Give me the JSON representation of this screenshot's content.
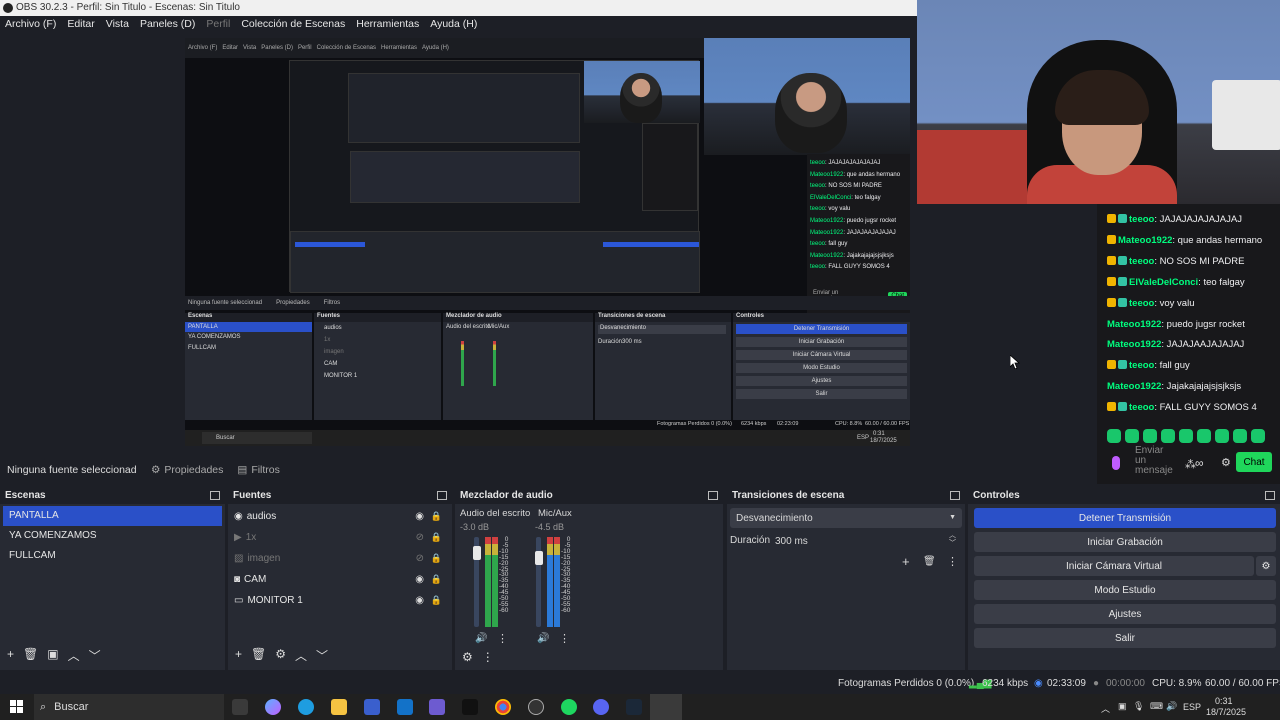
{
  "window": {
    "title": "OBS 30.2.3 - Perfil: Sin Titulo - Escenas: Sin Titulo"
  },
  "menu": [
    {
      "label": "Archivo (F)",
      "disabled": false
    },
    {
      "label": "Editar",
      "disabled": false
    },
    {
      "label": "Vista",
      "disabled": false
    },
    {
      "label": "Paneles (D)",
      "disabled": false
    },
    {
      "label": "Perfil",
      "disabled": true
    },
    {
      "label": "Colección de Escenas",
      "disabled": false
    },
    {
      "label": "Herramientas",
      "disabled": false
    },
    {
      "label": "Ayuda (H)",
      "disabled": false
    }
  ],
  "preview_inner": {
    "menu": [
      "Archivo (F)",
      "Editar",
      "Vista",
      "Paneles (D)",
      "Perfil",
      "Colección de Escenas",
      "Herramientas",
      "Ayuda (H)"
    ],
    "source_bar": [
      "Ninguna fuente seleccionad",
      "Propiedades",
      "Filtros"
    ],
    "scenes_title": "Escenas",
    "scenes": [
      "PANTALLA",
      "YA COMENZAMOS",
      "FULLCAM"
    ],
    "sources_title": "Fuentes",
    "sources": [
      "audios",
      "1x",
      "imagen",
      "CAM",
      "MONITOR 1"
    ],
    "mixer_title": "Mezclador de audio",
    "mixer_channels": [
      "Audio del escrito",
      "Mic/Aux"
    ],
    "transitions_title": "Transiciones de escena",
    "transition": "Desvanecimiento",
    "duration_label": "Duración",
    "duration_value": "300 ms",
    "controls_title": "Controles",
    "controls": [
      "Detener Transmisión",
      "Iniciar Grabación",
      "Iniciar Cámara Virtual",
      "Modo Estudio",
      "Ajustes",
      "Salir"
    ],
    "status": [
      "Fotogramas Perdidos 0 (0.0%)",
      "6234 kbps",
      "02:23:09",
      "CPU: 8.8%",
      "60.00 / 60.00 FPS"
    ],
    "chat": [
      {
        "user": "teeoo",
        "text": "JAJAJAJAJAJAJAJ"
      },
      {
        "user": "Mateoo1922",
        "text": "que andas hermano"
      },
      {
        "user": "teeoo",
        "text": "NO SOS MI PADRE"
      },
      {
        "user": "ElValeDelConci",
        "text": "teo falgay"
      },
      {
        "user": "teeoo",
        "text": "voy valu"
      },
      {
        "user": "Mateoo1922",
        "text": "puedo jugsr rocket"
      },
      {
        "user": "Mateoo1922",
        "text": "JAJAJAAJAJAJAJ"
      },
      {
        "user": "teeoo",
        "text": "fall guy"
      },
      {
        "user": "Mateoo1922",
        "text": "Jajakajajajsjsjksjs"
      },
      {
        "user": "teeoo",
        "text": "FALL GUYY SOMOS 4"
      }
    ],
    "chat_placeholder": "Enviar un mensaje",
    "chat_button": "Chat",
    "taskbar_search": "Buscar",
    "clock_time": "0:31",
    "clock_date": "18/7/2025",
    "tray_lang": "ESP"
  },
  "source_toolbar": {
    "no_source": "Ninguna fuente seleccionad",
    "properties": "Propiedades",
    "filters": "Filtros"
  },
  "scenes": {
    "title": "Escenas",
    "items": [
      {
        "label": "PANTALLA",
        "selected": true
      },
      {
        "label": "YA COMENZAMOS",
        "selected": false
      },
      {
        "label": "FULLCAM",
        "selected": false
      }
    ]
  },
  "sources": {
    "title": "Fuentes",
    "items": [
      {
        "label": "audios",
        "icon": "audio-icon",
        "visible": true,
        "dim": false
      },
      {
        "label": "1x",
        "icon": "media-play-icon",
        "visible": false,
        "dim": true
      },
      {
        "label": "imagen",
        "icon": "image-icon",
        "visible": false,
        "dim": true
      },
      {
        "label": "CAM",
        "icon": "camera-icon",
        "visible": true,
        "dim": false
      },
      {
        "label": "MONITOR 1",
        "icon": "monitor-icon",
        "visible": true,
        "dim": false
      }
    ]
  },
  "mixer": {
    "title": "Mezclador de audio",
    "channels": [
      {
        "name": "Audio del escrito",
        "db": "-3.0 dB"
      },
      {
        "name": "Mic/Aux",
        "db": "-4.5 dB"
      }
    ],
    "scale": [
      "0",
      "-5",
      "-10",
      "-15",
      "-20",
      "-25",
      "-30",
      "-35",
      "-40",
      "-45",
      "-50",
      "-55",
      "-60"
    ]
  },
  "transitions": {
    "title": "Transiciones de escena",
    "selected": "Desvanecimiento",
    "duration_label": "Duración",
    "duration_value": "300 ms"
  },
  "controls": {
    "title": "Controles",
    "stop_stream": "Detener Transmisión",
    "start_record": "Iniciar Grabación",
    "start_vcam": "Iniciar Cámara Virtual",
    "studio_mode": "Modo Estudio",
    "settings": "Ajustes",
    "exit": "Salir"
  },
  "chat": {
    "messages": [
      {
        "user": "teeoo",
        "text": "JAJAJAJAJAJAJAJ",
        "badges": 2
      },
      {
        "user": "Mateoo1922",
        "text": "que andas hermano",
        "badges": 1
      },
      {
        "user": "teeoo",
        "text": "NO SOS MI PADRE",
        "badges": 2
      },
      {
        "user": "ElValeDelConci",
        "text": "teo falgay",
        "badges": 2
      },
      {
        "user": "teeoo",
        "text": "voy valu",
        "badges": 2
      },
      {
        "user": "Mateoo1922",
        "text": "puedo jugsr rocket",
        "badges": 0
      },
      {
        "user": "Mateoo1922",
        "text": "JAJAJAAJAJAJAJ",
        "badges": 0
      },
      {
        "user": "teeoo",
        "text": "fall guy",
        "badges": 2
      },
      {
        "user": "Mateoo1922",
        "text": "Jajakajajajsjsjksjs",
        "badges": 0
      },
      {
        "user": "teeoo",
        "text": "FALL GUYY SOMOS 4",
        "badges": 2
      }
    ],
    "placeholder": "Enviar un mensaje",
    "send_button": "Chat"
  },
  "status": {
    "dropped": "Fotogramas Perdidos 0 (0.0%)",
    "bitrate": "6234 kbps",
    "stream_time": "02:33:09",
    "record_time": "00:00:00",
    "cpu": "CPU: 8.9%",
    "fps": "60.00 / 60.00 FPS"
  },
  "taskbar": {
    "search": "Buscar",
    "lang": "ESP",
    "time": "0:31",
    "date": "18/7/2025"
  },
  "colors": {
    "accent": "#2a50c8",
    "panel": "#272a33",
    "background": "#1d1f26",
    "chat_user": "#00ff7f",
    "chat_button": "#1fd65b"
  }
}
